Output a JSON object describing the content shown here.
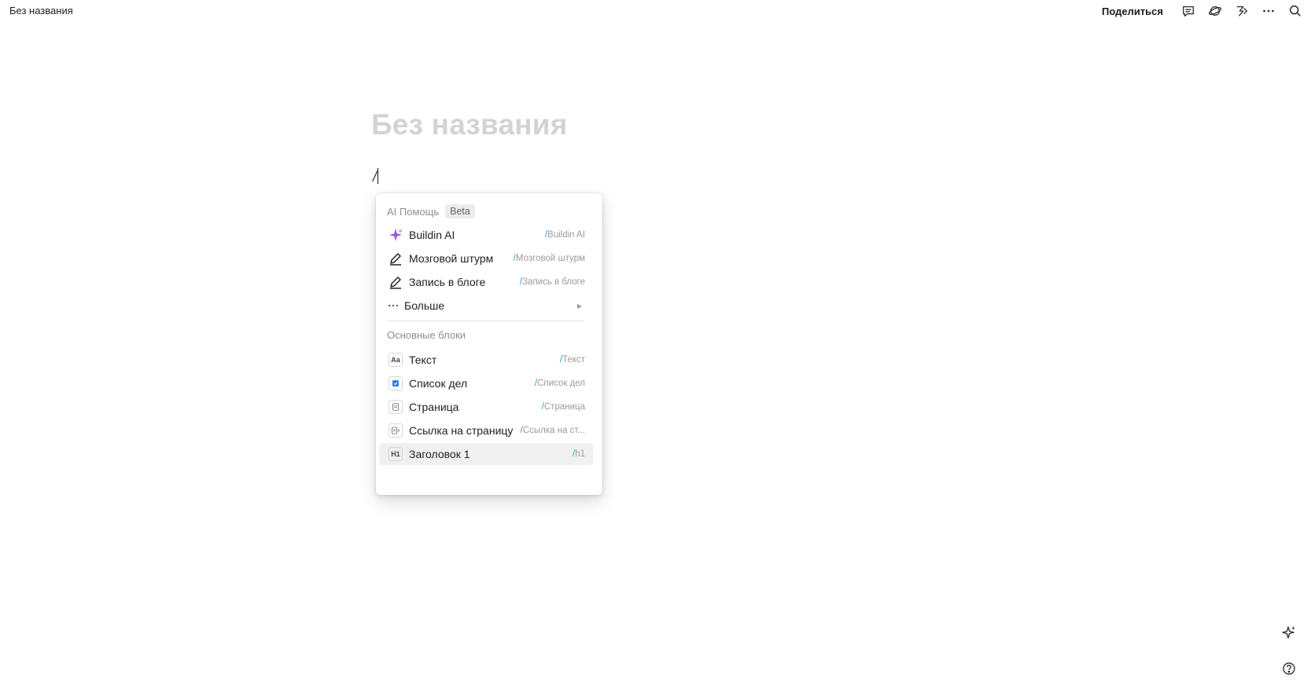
{
  "header": {
    "breadcrumb": "Без названия",
    "share_label": "Поделиться",
    "icons": [
      "comment-icon",
      "planet-icon",
      "updates-icon",
      "more-icon",
      "search-icon"
    ]
  },
  "document": {
    "title_placeholder": "Без названия",
    "input_text": "/"
  },
  "menu": {
    "ai_section_label": "AI Помощь",
    "ai_badge": "Beta",
    "ai_items": [
      {
        "label": "Buildin AI",
        "shortcut_slash": "/",
        "shortcut": "Buildin AI",
        "icon": "sparkle-icon"
      },
      {
        "label": "Мозговой штурм",
        "shortcut_slash": "/",
        "shortcut": "Мозговой штурм",
        "icon": "pen-icon"
      },
      {
        "label": "Запись в блоге",
        "shortcut_slash": "/",
        "shortcut": "Запись в блоге",
        "icon": "pen-icon"
      }
    ],
    "more_label": "Больше",
    "basic_section_label": "Основные блоки",
    "basic_items": [
      {
        "label": "Текст",
        "shortcut_slash": "/",
        "shortcut": "Текст",
        "icon": "text-icon",
        "glyph": "Aa"
      },
      {
        "label": "Список дел",
        "shortcut_slash": "/",
        "shortcut": "Список дел",
        "icon": "todo-icon"
      },
      {
        "label": "Страница",
        "shortcut_slash": "/",
        "shortcut": "Страница",
        "icon": "page-icon"
      },
      {
        "label": "Ссылка на страницу",
        "shortcut_slash": "/",
        "shortcut": "Ссылка на ст...",
        "icon": "page-link-icon"
      },
      {
        "label": "Заголовок 1",
        "shortcut_slash": "/",
        "shortcut": "h1",
        "icon": "heading-icon",
        "glyph": "H1"
      }
    ]
  },
  "colors": {
    "accent_purple": "#9b59d6",
    "slash_blue": "#2f9bd6",
    "todo_blue": "#2f80ed",
    "title_placeholder_gray": "#d3d3d3"
  }
}
